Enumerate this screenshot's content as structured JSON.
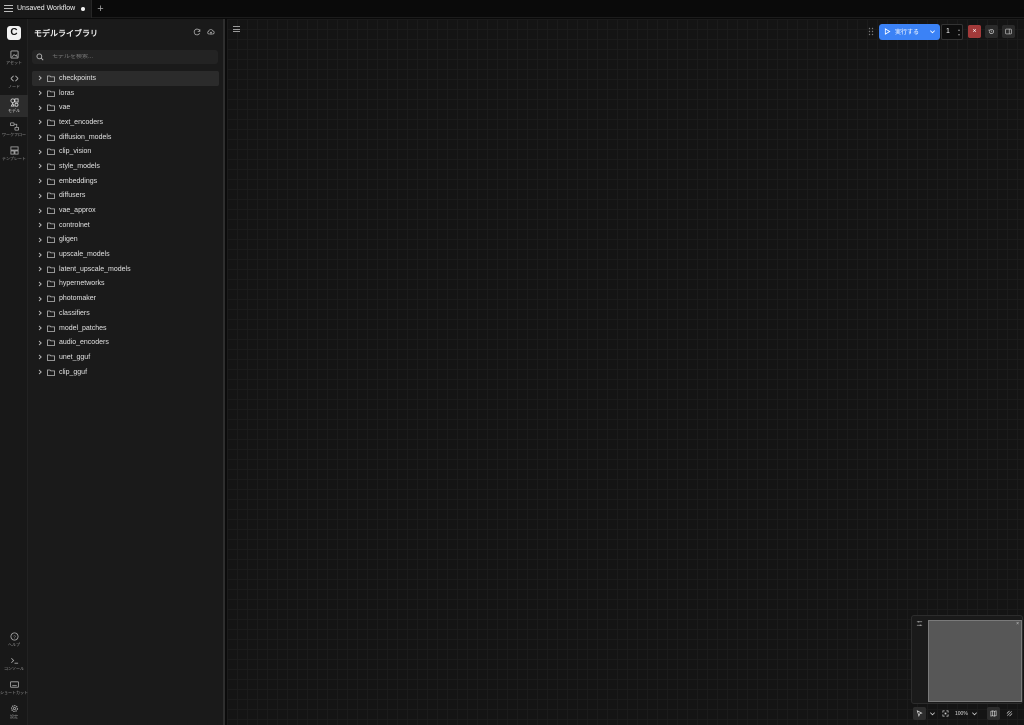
{
  "tab": {
    "title": "Unsaved Workflow",
    "plus": "+"
  },
  "rail": {
    "logo": "C",
    "items": [
      {
        "label": "アセット",
        "icon": "image-icon"
      },
      {
        "label": "ノード",
        "icon": "node-icon"
      },
      {
        "label": "モデル",
        "icon": "model-icon"
      },
      {
        "label": "ワークフロー",
        "icon": "workflow-icon"
      },
      {
        "label": "テンプレート",
        "icon": "template-icon"
      }
    ],
    "bottom_items": [
      {
        "label": "ヘルプ",
        "icon": "help-icon"
      },
      {
        "label": "コンソール",
        "icon": "console-icon"
      },
      {
        "label": "ショートカット",
        "icon": "keyboard-icon"
      },
      {
        "label": "設定",
        "icon": "gear-icon"
      }
    ]
  },
  "panel": {
    "title": "モデルライブラリ",
    "search_placeholder": "モデルを検索...",
    "folders": [
      "checkpoints",
      "loras",
      "vae",
      "text_encoders",
      "diffusion_models",
      "clip_vision",
      "style_models",
      "embeddings",
      "diffusers",
      "vae_approx",
      "controlnet",
      "gligen",
      "upscale_models",
      "latent_upscale_models",
      "hypernetworks",
      "photomaker",
      "classifiers",
      "model_patches",
      "audio_encoders",
      "unet_gguf",
      "clip_gguf"
    ]
  },
  "toolbar": {
    "run_label": "実行する",
    "queue_count": "1",
    "stop": "×"
  },
  "bottom": {
    "zoom": "100%"
  },
  "colors": {
    "accent": "#3b82f6",
    "stop": "#a33a3a",
    "canvas": "#141414",
    "panel": "#1a1a1a"
  }
}
